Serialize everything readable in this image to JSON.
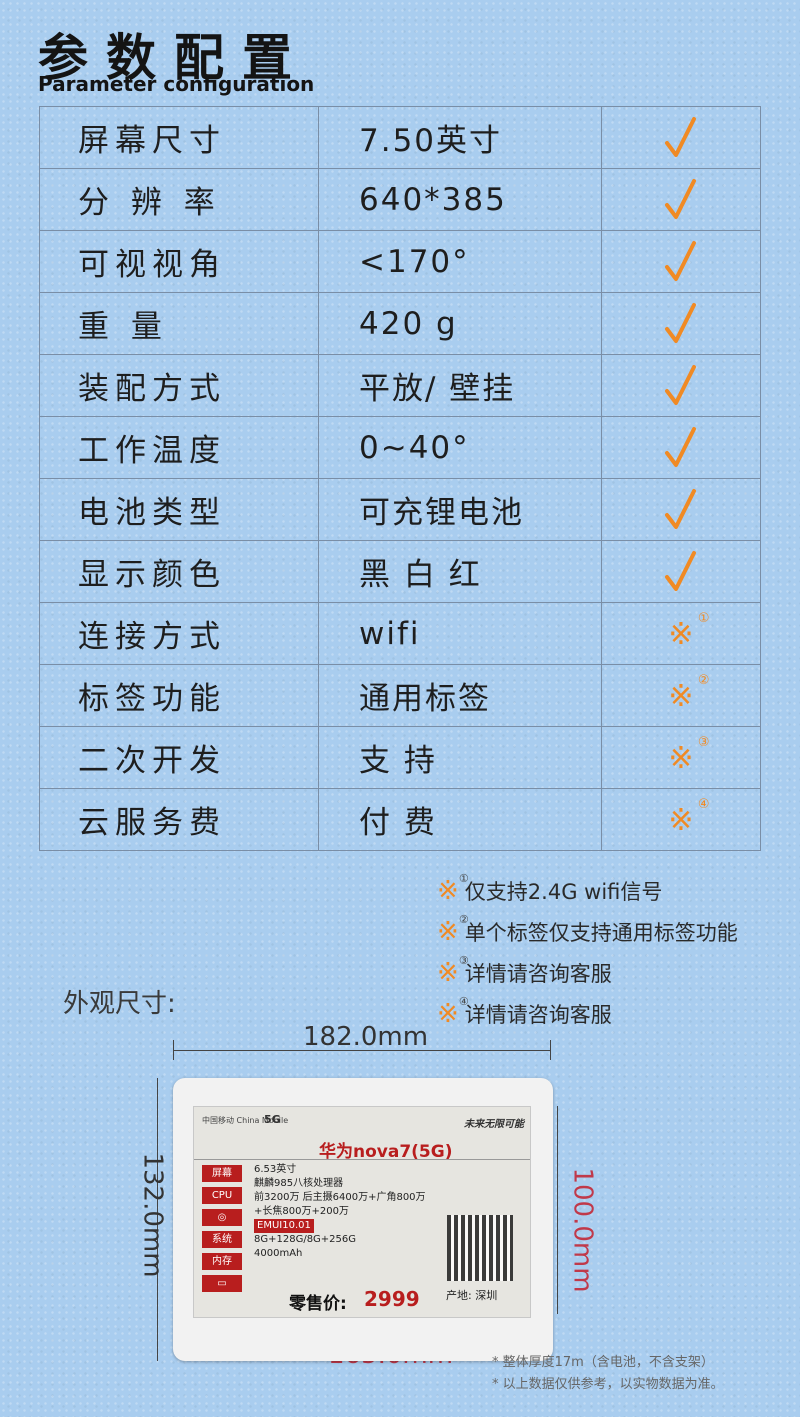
{
  "header": {
    "title_cn": "参数配置",
    "title_en": "Parameter configuration"
  },
  "specs": [
    {
      "name": "屏幕尺寸",
      "value": "7.50英寸",
      "mark": "check"
    },
    {
      "name": "分 辨 率",
      "value": "640*385",
      "mark": "check"
    },
    {
      "name": "可视视角",
      "value": "<170°",
      "mark": "check"
    },
    {
      "name": "重      量",
      "value": "420 g",
      "mark": "check"
    },
    {
      "name": "装配方式",
      "value": "平放/ 壁挂",
      "mark": "check"
    },
    {
      "name": "工作温度",
      "value": "0~40°",
      "mark": "check"
    },
    {
      "name": "电池类型",
      "value": "可充锂电池",
      "mark": "check"
    },
    {
      "name": "显示颜色",
      "value": "黑 白 红",
      "mark": "check"
    },
    {
      "name": "连接方式",
      "value": "wifi",
      "mark": "※",
      "sup": "①"
    },
    {
      "name": "标签功能",
      "value": "通用标签",
      "mark": "※",
      "sup": "②"
    },
    {
      "name": "二次开发",
      "value": "支 持",
      "mark": "※",
      "sup": "③"
    },
    {
      "name": "云服务费",
      "value": "付 费",
      "mark": "※",
      "sup": "④"
    }
  ],
  "notes": [
    {
      "mark": "※",
      "sup": "①",
      "text": "仅支持2.4G wifi信号"
    },
    {
      "mark": "※",
      "sup": "②",
      "text": "单个标签仅支持通用标签功能"
    },
    {
      "mark": "※",
      "sup": "③",
      "text": "详情请咨询客服"
    },
    {
      "mark": "※",
      "sup": "④",
      "text": "详情请咨询客服"
    }
  ],
  "appearance": {
    "label": "外观尺寸:",
    "width_outer": "182.0mm",
    "height_outer": "132.0mm",
    "height_screen": "100.0mm",
    "width_screen": "165.0mm"
  },
  "screen": {
    "brand": "中国移动 China Mobile",
    "network": "5G",
    "slogan": "未来无限可能",
    "product": "华为nova7(5G)",
    "labels": [
      "屏幕",
      "CPU",
      "",
      "系统",
      "内存"
    ],
    "screen_size": "6.53英寸",
    "cpu": "麒麟985八核处理器",
    "camera1": "前3200万 后主摄6400万+广角800万",
    "camera2": "+长焦800万+200万",
    "system": "EMUI10.01",
    "memory": "8G+128G/8G+256G",
    "battery": "4000mAh",
    "price_label": "零售价:",
    "price": "2999",
    "origin": "产地: 深圳"
  },
  "footnotes": [
    "* 整体厚度17m（含电池，不含支架）",
    "* 以上数据仅供参考，以实物数据为准。"
  ],
  "colors": {
    "background": "#a9cdef",
    "accent": "#f08a24",
    "screen_red": "#b81e1e"
  }
}
